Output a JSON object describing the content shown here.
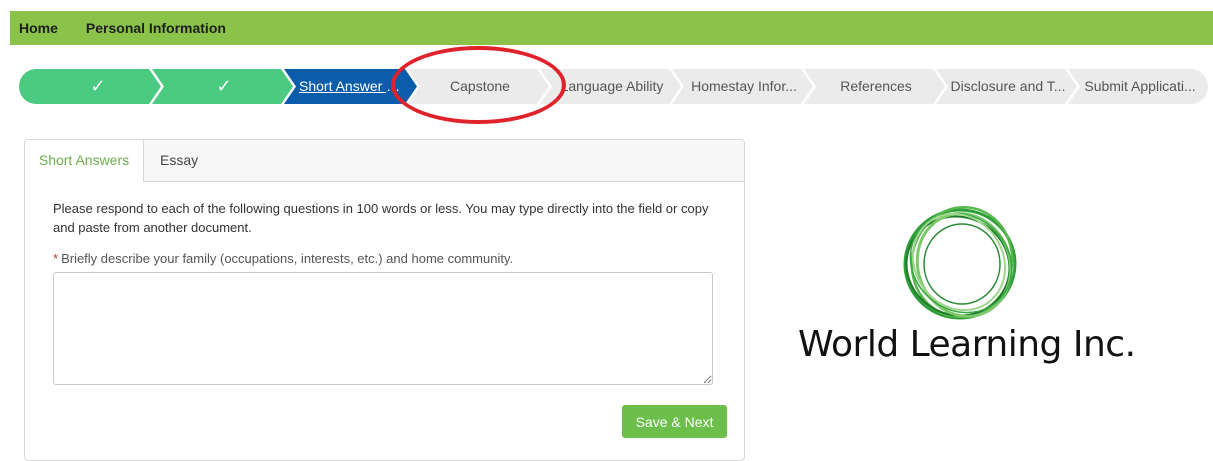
{
  "top_nav": {
    "items": [
      {
        "label": "Home"
      },
      {
        "label": "Personal Information"
      }
    ]
  },
  "progress_steps": [
    {
      "label": "✓",
      "state": "complete"
    },
    {
      "label": "✓",
      "state": "complete"
    },
    {
      "label": "Short Answer a...",
      "state": "current"
    },
    {
      "label": "Capstone",
      "state": "upcoming"
    },
    {
      "label": "Language Ability",
      "state": "upcoming"
    },
    {
      "label": "Homestay Infor...",
      "state": "upcoming"
    },
    {
      "label": "References",
      "state": "upcoming"
    },
    {
      "label": "Disclosure and T...",
      "state": "upcoming"
    },
    {
      "label": "Submit Applicati...",
      "state": "upcoming"
    }
  ],
  "tabs": {
    "short_answers": "Short Answers",
    "essay": "Essay"
  },
  "form": {
    "intro": "Please respond to each of the following questions in 100 words or less. You may type directly into the field or copy and paste from another document.",
    "required_marker": "*",
    "question": "Briefly describe your family (occupations, interests, etc.) and home community.",
    "answer_value": "",
    "save_label": "Save & Next"
  },
  "logo": {
    "text": "World Learning Inc."
  },
  "colors": {
    "nav_green": "#8bc34a",
    "step_complete": "#4bca81",
    "step_current": "#0b5cab",
    "step_upcoming": "#ebebeb",
    "annotation_red": "#e0222b",
    "button_green": "#6cbf4a"
  }
}
